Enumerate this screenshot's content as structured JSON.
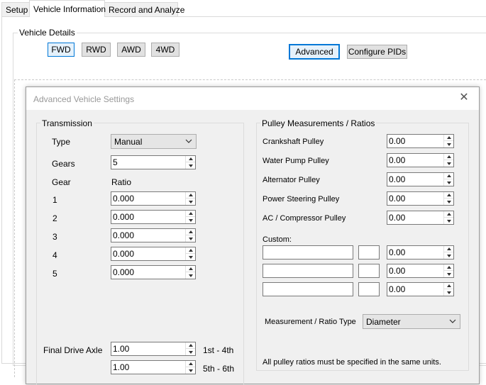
{
  "tabs": [
    {
      "label": "Setup"
    },
    {
      "label": "Vehicle Information"
    },
    {
      "label": "Record and Analyze"
    }
  ],
  "vehicle_details": {
    "title": "Vehicle Details",
    "drive_buttons": [
      "FWD",
      "RWD",
      "AWD",
      "4WD"
    ],
    "selected_drive": "FWD",
    "advanced_label": "Advanced",
    "configure_label": "Configure PIDs"
  },
  "dialog": {
    "title": "Advanced Vehicle Settings",
    "close_glyph": "✕",
    "transmission": {
      "title": "Transmission",
      "type_label": "Type",
      "type_value": "Manual",
      "gears_label": "Gears",
      "gears_value": "5",
      "gear_header": "Gear",
      "ratio_header": "Ratio",
      "gears": [
        {
          "gear": "1",
          "ratio": "0.000"
        },
        {
          "gear": "2",
          "ratio": "0.000"
        },
        {
          "gear": "3",
          "ratio": "0.000"
        },
        {
          "gear": "4",
          "ratio": "0.000"
        },
        {
          "gear": "5",
          "ratio": "0.000"
        }
      ],
      "final_drive_label": "Final Drive Axle",
      "final_drive": [
        {
          "value": "1.00",
          "range": "1st - 4th"
        },
        {
          "value": "1.00",
          "range": "5th - 6th"
        }
      ]
    },
    "pulley": {
      "title": "Pulley Measurements / Ratios",
      "items": [
        {
          "label": "Crankshaft Pulley",
          "value": "0.00"
        },
        {
          "label": "Water Pump Pulley",
          "value": "0.00"
        },
        {
          "label": "Alternator Pulley",
          "value": "0.00"
        },
        {
          "label": "Power Steering Pulley",
          "value": "0.00"
        },
        {
          "label": "AC / Compressor Pulley",
          "value": "0.00"
        }
      ],
      "custom_label": "Custom:",
      "custom_rows": [
        {
          "name": "",
          "code": "",
          "value": "0.00"
        },
        {
          "name": "",
          "code": "",
          "value": "0.00"
        },
        {
          "name": "",
          "code": "",
          "value": "0.00"
        }
      ],
      "type_label": "Measurement / Ratio Type",
      "type_value": "Diameter",
      "note": "All pulley ratios must be specified in the same units."
    }
  }
}
